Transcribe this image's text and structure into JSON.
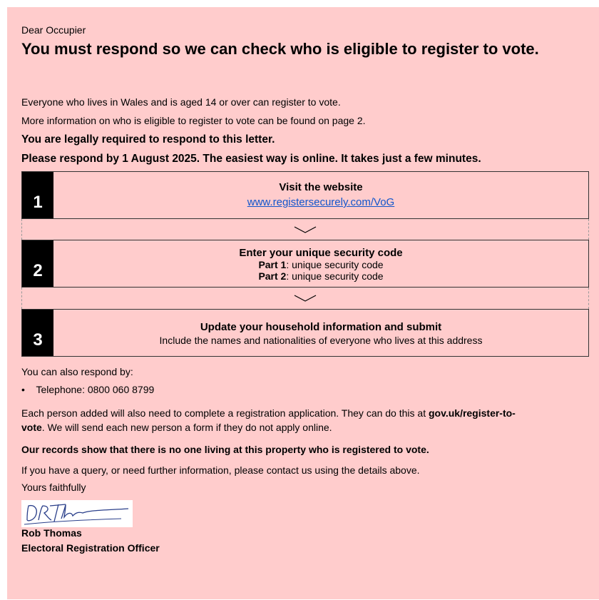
{
  "letter": {
    "greeting": "Dear Occupier",
    "headline": "You must respond so we can check who is eligible to register to vote.",
    "para1": "Everyone who lives in Wales and is aged 14 or over can register to vote.",
    "para2": "More information on who is eligible to register to vote can be found on page 2.",
    "bold1": "You are legally required to respond to this letter.",
    "bold2": "Please respond by 1 August 2025. The easiest way is online. It takes just a few minutes.",
    "steps": [
      {
        "number": "1",
        "title": "Visit the website",
        "link": "www.registersecurely.com/VoG"
      },
      {
        "number": "2",
        "title": "Enter your unique security code",
        "part1_label": "Part 1",
        "part1_text": ": unique security code",
        "part2_label": "Part 2",
        "part2_text": ": unique security code"
      },
      {
        "number": "3",
        "title": "Update your household information and submit",
        "subtitle": "Include the names and nationalities of everyone who lives at this address"
      }
    ],
    "also_respond": "You can also respond by:",
    "bullet_symbol": "•",
    "telephone": "Telephone: 0800 060 8799",
    "para3_start": "Each person added will also need to complete a registration application. They can do this at ",
    "para3_link": "gov.uk/register-to-vote",
    "para3_end": ". We will send each new person a form if they do not apply online.",
    "bold3": "Our records show that there is no one living at this property who is registered to vote.",
    "query": "If you have a query, or need further information, please contact us using the details above.",
    "closing": "Yours faithfully",
    "signature_text": "DRThomas",
    "signer_name": "Rob Thomas",
    "signer_title": "Electoral Registration Officer"
  },
  "colors": {
    "page_background": "#ffcccc",
    "link": "#1155cc",
    "step_number_background": "#000000"
  },
  "icons": {
    "connector": "chevron-down-icon"
  }
}
